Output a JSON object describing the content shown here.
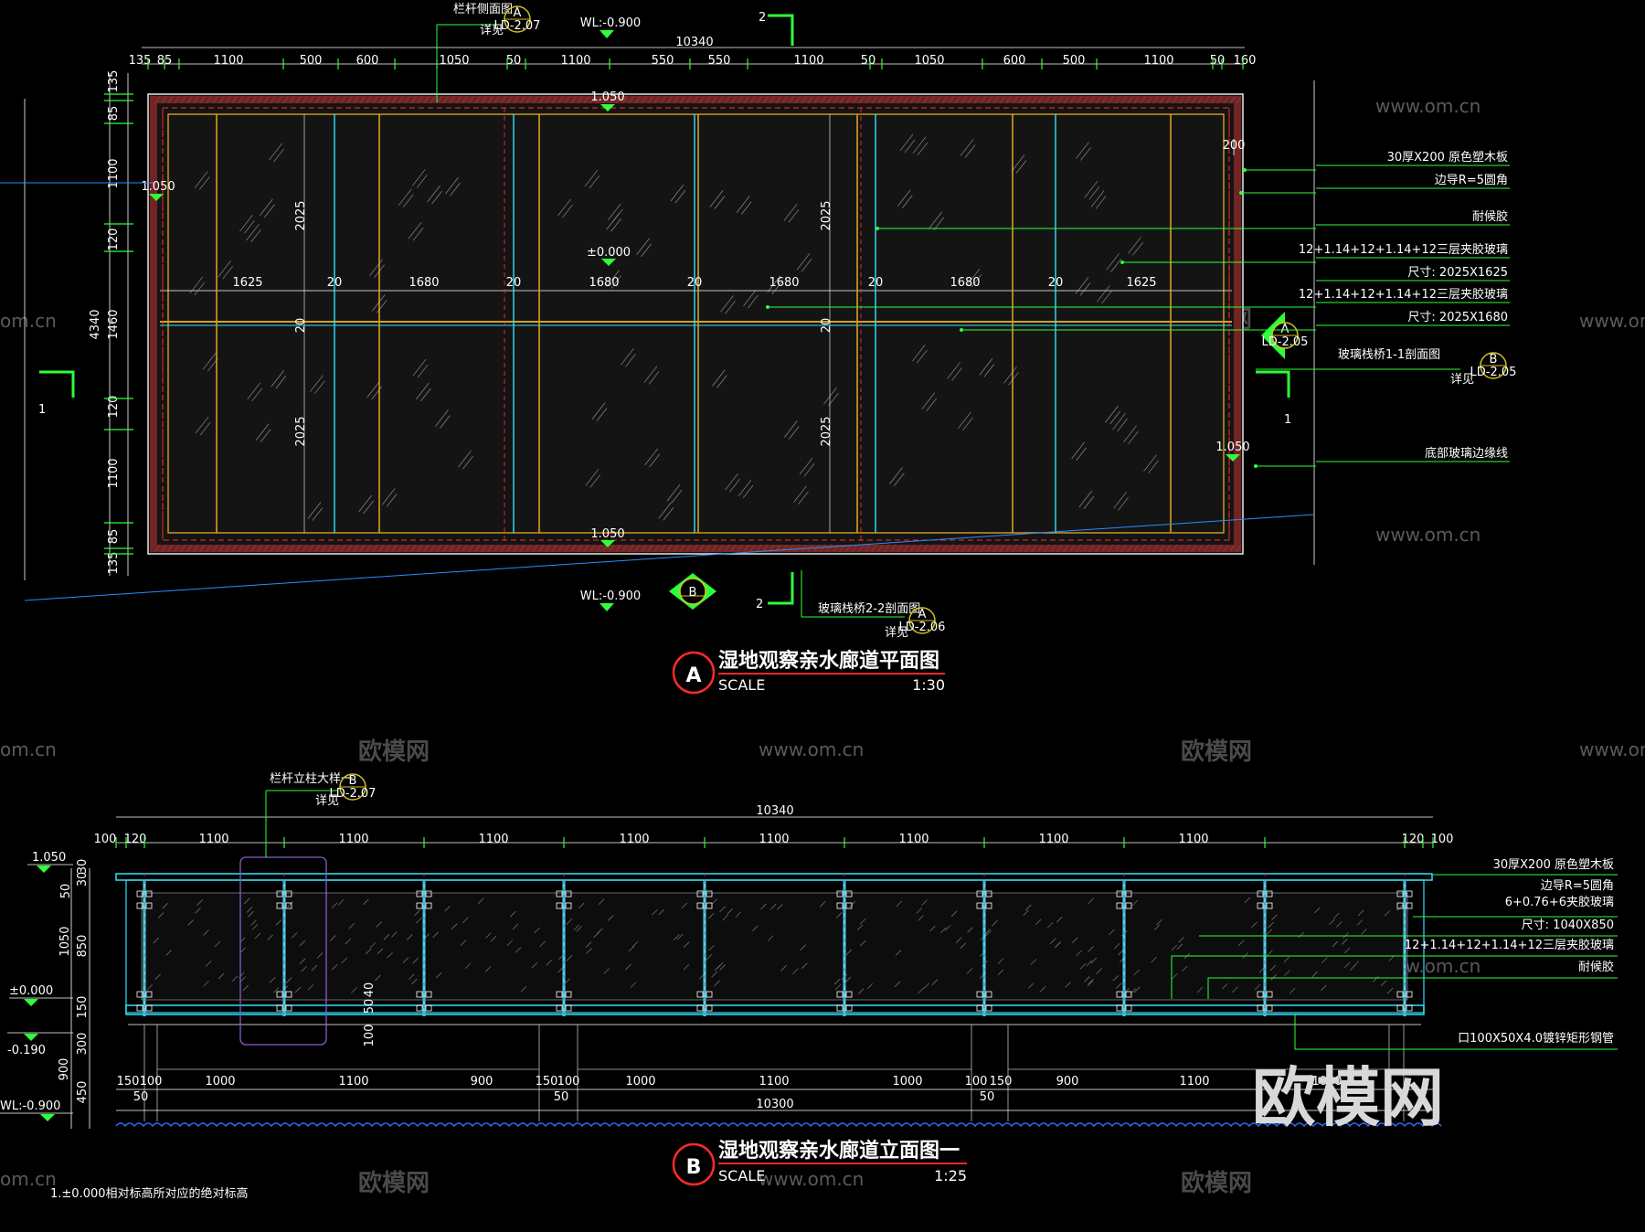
{
  "plan": {
    "title": "湿地观察亲水廊道平面图",
    "marker": "A",
    "scale_label": "SCALE",
    "scale_value": "1:30",
    "overall_width": "10340",
    "overall_height": "4340",
    "wl_top": "WL:-0.900",
    "wl_bottom": "WL:-0.900",
    "section_num_top": "2",
    "section_num_bottom": "2",
    "section_num_left": "1",
    "section_num_right": "1",
    "level_top": "1.050",
    "level_bottom": "1.050",
    "level_left": "1.050",
    "level_right": "1.050",
    "level_center": "±0.000",
    "top_dims": [
      "135",
      "85",
      "1100",
      "500",
      "600",
      "1050",
      "50",
      "1100",
      "550",
      "550",
      "1100",
      "50",
      "1050",
      "600",
      "500",
      "1100",
      "50",
      "160"
    ],
    "left_dims": [
      "135",
      "85",
      "1100",
      "120",
      "1460",
      "120",
      "1100",
      "85",
      "135"
    ],
    "panel_dims": [
      "1625",
      "20",
      "1680",
      "20",
      "1680",
      "20",
      "1680",
      "20",
      "1680",
      "20",
      "1625"
    ],
    "inner_v": [
      "2025",
      "2025",
      "2025",
      "2025"
    ],
    "inner_mid": [
      "20",
      "20"
    ],
    "right_dim": "200",
    "callout_top": {
      "text": "栏杆侧面图",
      "sub": "详见",
      "mark": "A",
      "ref": "LD-2.07"
    },
    "callout_bottom": {
      "text": "玻璃栈桥2-2剖面图",
      "sub": "详见",
      "mark": "A",
      "ref": "LD-2.06"
    },
    "callout_right": {
      "text": "玻璃栈桥1-1剖面图",
      "sub": "详见",
      "mark": "B",
      "ref": "LD-2.05"
    },
    "right_marker": {
      "mark": "A",
      "ref": "LD-2.05"
    },
    "bottom_marker": {
      "mark": "B"
    },
    "notes": [
      "30厚X200  原色塑木板",
      "边导R=5圆角",
      "耐候胶",
      "12+1.14+12+1.14+12三层夹胶玻璃",
      "尺寸: 2025X1625",
      "12+1.14+12+1.14+12三层夹胶玻璃",
      "尺寸: 2025X1680",
      "底部玻璃边缘线"
    ]
  },
  "elev": {
    "title": "湿地观察亲水廊道立面图一",
    "marker": "B",
    "scale_label": "SCALE",
    "scale_value": "1:25",
    "overall_top": "10340",
    "overall_bottom": "10300",
    "top_dims": [
      "100",
      "120",
      "1100",
      "1100",
      "1100",
      "1100",
      "1100",
      "1100",
      "1100",
      "1100",
      "120",
      "100"
    ],
    "bottom_dims": [
      "150",
      "100",
      "1000",
      "1100",
      "900",
      "150",
      "100",
      "1000",
      "1100",
      "1000",
      "100",
      "150",
      "900",
      "1100",
      "1000"
    ],
    "bottom_dims2": [
      "50",
      "50",
      "50"
    ],
    "left_dims": [
      "30",
      "30",
      "50",
      "1050",
      "850",
      "150",
      "300",
      "900",
      "450"
    ],
    "small_dims": [
      "50",
      "40",
      "100"
    ],
    "levels": [
      "1.050",
      "±0.000",
      "-0.190",
      "WL:-0.900"
    ],
    "callout": {
      "text": "栏杆立柱大样一",
      "sub": "详见",
      "mark": "B",
      "ref": "LD-2.07"
    },
    "notes": [
      "30厚X200  原色塑木板",
      "边导R=5圆角",
      "6+0.76+6夹胶玻璃",
      "尺寸: 1040X850",
      "12+1.14+12+1.14+12三层夹胶玻璃",
      "耐候胶",
      "口100X50X4.0镀锌矩形钢管"
    ]
  },
  "footnote": "1.±0.000相对标高所对应的绝对标高",
  "watermarks": {
    "url": "www.om.cn",
    "cn": "欧模网",
    "logo": "欧模网",
    "cn_short": "om.cn"
  }
}
